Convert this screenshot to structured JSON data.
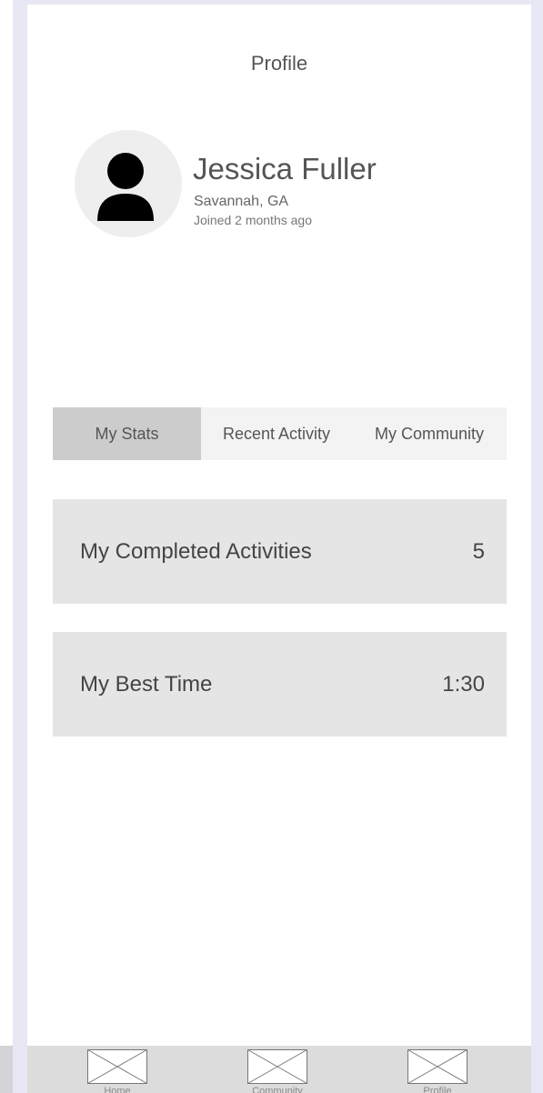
{
  "header": {
    "title": "Profile"
  },
  "profile": {
    "name": "Jessica Fuller",
    "location": "Savannah, GA",
    "joined": "Joined 2 months ago"
  },
  "tabs": [
    {
      "label": "My Stats",
      "active": true
    },
    {
      "label": "Recent Activity",
      "active": false
    },
    {
      "label": "My Community",
      "active": false
    }
  ],
  "stats": [
    {
      "label": "My Completed Activities",
      "value": "5"
    },
    {
      "label": "My Best Time",
      "value": "1:30"
    }
  ],
  "bottom_nav": [
    {
      "label": "Home",
      "icon": "image-placeholder-icon"
    },
    {
      "label": "Community",
      "icon": "image-placeholder-icon"
    },
    {
      "label": "Profile",
      "icon": "image-placeholder-icon"
    }
  ],
  "colors": {
    "background": "#e8e8f4",
    "active_tab": "#cccccc",
    "card": "#e5e5e5",
    "nav_bar": "#dcdcdc"
  }
}
